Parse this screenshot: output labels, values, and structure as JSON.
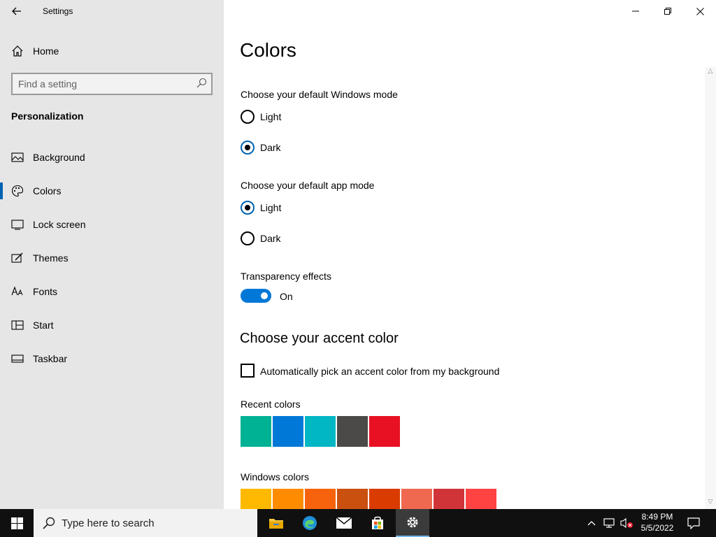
{
  "window": {
    "title": "Settings"
  },
  "sidebar": {
    "home_label": "Home",
    "search_placeholder": "Find a setting",
    "section_title": "Personalization",
    "items": [
      {
        "label": "Background",
        "icon": "picture-icon"
      },
      {
        "label": "Colors",
        "icon": "palette-icon",
        "active": true
      },
      {
        "label": "Lock screen",
        "icon": "lock-screen-icon"
      },
      {
        "label": "Themes",
        "icon": "themes-icon"
      },
      {
        "label": "Fonts",
        "icon": "fonts-icon"
      },
      {
        "label": "Start",
        "icon": "start-icon"
      },
      {
        "label": "Taskbar",
        "icon": "taskbar-icon"
      }
    ]
  },
  "main": {
    "title": "Colors",
    "windows_mode": {
      "label": "Choose your default Windows mode",
      "options": [
        "Light",
        "Dark"
      ],
      "selected": "Dark"
    },
    "app_mode": {
      "label": "Choose your default app mode",
      "options": [
        "Light",
        "Dark"
      ],
      "selected": "Light"
    },
    "transparency": {
      "label": "Transparency effects",
      "state": "On",
      "on": true
    },
    "accent_heading": "Choose your accent color",
    "auto_accent_label": "Automatically pick an accent color from my background",
    "auto_accent_checked": false,
    "recent_colors_label": "Recent colors",
    "recent_colors": [
      "#00b294",
      "#0078d7",
      "#00b7c3",
      "#4c4a48",
      "#e81123"
    ],
    "windows_colors_label": "Windows colors",
    "windows_colors": [
      "#ffb900",
      "#ff8c00",
      "#f7630c",
      "#ca5010",
      "#da3b01",
      "#ef6950",
      "#d13438",
      "#ff4343"
    ]
  },
  "taskbar": {
    "search_placeholder": "Type here to search",
    "time": "8:49 PM",
    "date": "5/5/2022",
    "accent": "#76b9ed"
  }
}
